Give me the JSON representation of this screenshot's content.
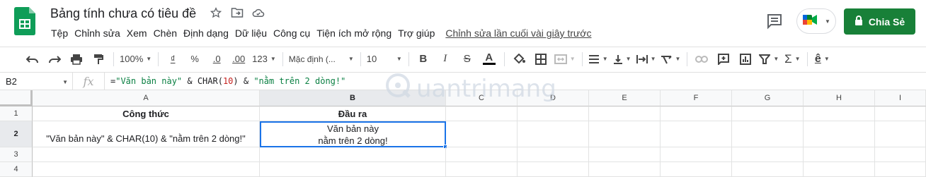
{
  "app": {
    "title": "Bảng tính chưa có tiêu đề",
    "brand_color": "#188038",
    "accent_color": "#1a73e8"
  },
  "menu": [
    "Tệp",
    "Chỉnh sửa",
    "Xem",
    "Chèn",
    "Định dạng",
    "Dữ liệu",
    "Công cụ",
    "Tiện ích mở rộng",
    "Trợ giúp"
  ],
  "last_edit": "Chỉnh sửa lần cuối vài giây trước",
  "share_label": "Chia Sẻ",
  "toolbar": {
    "zoom": "100%",
    "currency": "₫",
    "percent": "%",
    "dec_decrease": ".0",
    "dec_increase": ".00",
    "more_formats": "123",
    "font": "Mặc định (...",
    "font_size": "10",
    "bold": "B",
    "italic": "I",
    "strike": "S",
    "text_color": "A"
  },
  "namebox": "B2",
  "formula": {
    "p1": "=",
    "s1": "\"Văn bản này\"",
    "p2": " & CHAR(",
    "n1": "10",
    "p3": ") & ",
    "s2": "\"nằm trên 2 dòng!\""
  },
  "columns": [
    "A",
    "B",
    "C",
    "D",
    "E",
    "F",
    "G",
    "H",
    "I"
  ],
  "rows": [
    "1",
    "2",
    "3",
    "4"
  ],
  "cells": {
    "a1": "Công thức",
    "b1": "Đầu ra",
    "a2": "\"Văn bản này\" & CHAR(10) & \"nằm trên 2 dòng!\"",
    "b2": "Văn bản này\nnằm trên 2 dòng!"
  },
  "watermark": "uantrimang"
}
